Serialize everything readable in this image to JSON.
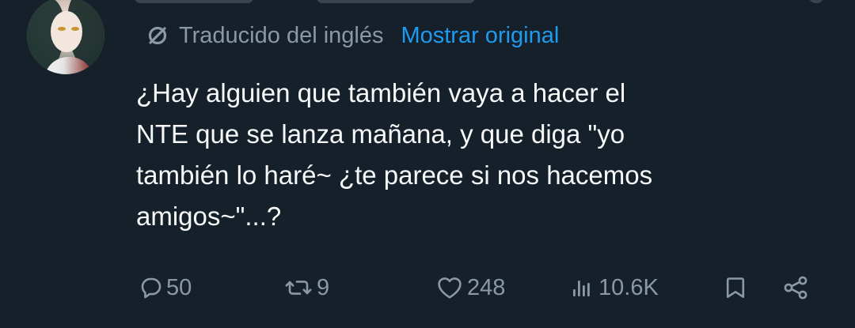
{
  "avatar": {
    "alt": "Profile avatar"
  },
  "translation": {
    "icon": "translate-slash-icon",
    "label": "Traducido del inglés",
    "action_label": "Mostrar original"
  },
  "tweet": {
    "lines": [
      "¿Hay alguien que también vaya a hacer el",
      "NTE que se lanza mañana, y que diga \"yo",
      "también lo haré~ ¿te parece si nos hacemos",
      "amigos~\"...?"
    ]
  },
  "actions": {
    "reply": {
      "icon": "reply-icon",
      "count": "50"
    },
    "retweet": {
      "icon": "retweet-icon",
      "count": "9"
    },
    "like": {
      "icon": "heart-icon",
      "count": "248"
    },
    "views": {
      "icon": "views-icon",
      "count": "10.6K"
    },
    "bookmark": {
      "icon": "bookmark-icon"
    },
    "share": {
      "icon": "share-icon"
    }
  },
  "colors": {
    "background": "#15202b",
    "text_primary": "#f7f9f9",
    "text_secondary": "#8b98a5",
    "link": "#1d9bf0"
  }
}
